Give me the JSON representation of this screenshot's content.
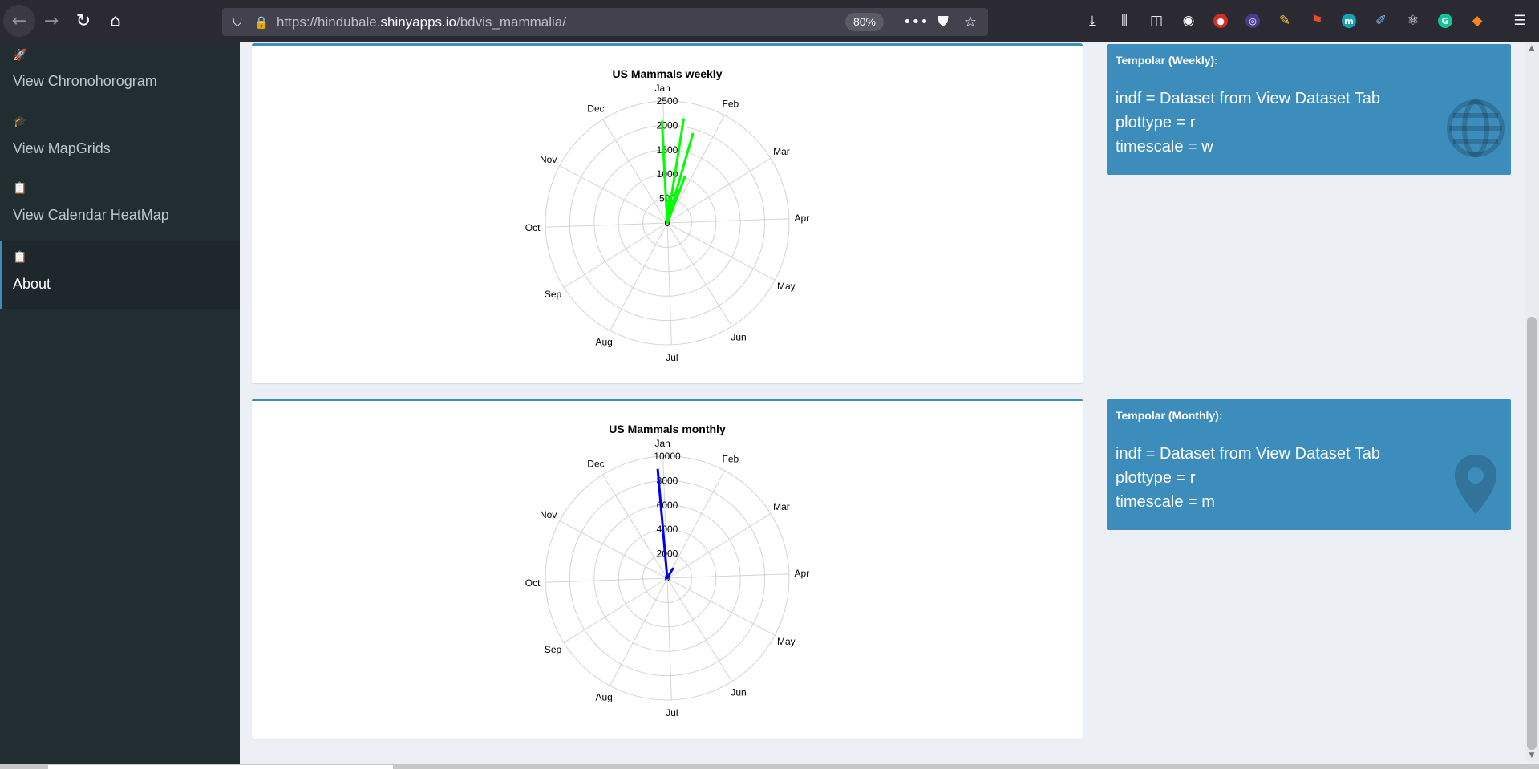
{
  "browser": {
    "url_prefix": "https://hindubale.",
    "url_domain": "shinyapps.io",
    "url_path": "/bdvis_mammalia/",
    "zoom": "80%",
    "icons": [
      "back-icon",
      "forward-icon",
      "reload-icon",
      "home-icon",
      "shield-icon",
      "lock-icon",
      "more-icon",
      "pocket-icon",
      "star-icon",
      "download-icon",
      "library-icon",
      "sidebar-icon",
      "account-icon",
      "extensions"
    ]
  },
  "sidebar": {
    "items": [
      {
        "label": "View Chronohorogram",
        "icon": "rocket-icon",
        "glyph": "🚀"
      },
      {
        "label": "View MapGrids",
        "icon": "graduation-cap-icon",
        "glyph": "🎓"
      },
      {
        "label": "View Calendar HeatMap",
        "icon": "clipboard-icon",
        "glyph": "📋"
      },
      {
        "label": "About",
        "icon": "clipboard-icon",
        "glyph": "📋",
        "active": true
      }
    ]
  },
  "colors": {
    "accent": "#3c8dbc",
    "weekly_series": "#00ff00",
    "monthly_series": "#0000ee",
    "sidebar_bg": "#222d32"
  },
  "info_boxes": [
    {
      "title": "Tempolar (Weekly):",
      "lines": [
        "indf = Dataset from View Dataset Tab",
        "plottype = r",
        "timescale = w"
      ],
      "icon": "globe-icon"
    },
    {
      "title": "Tempolar (Monthly):",
      "lines": [
        "indf = Dataset from View Dataset Tab",
        "plottype = r",
        "timescale = m"
      ],
      "icon": "map-marker-icon"
    }
  ],
  "chart_data": [
    {
      "type": "line",
      "polar": true,
      "title": "US Mammals weekly",
      "angular_labels": [
        "Jan",
        "Feb",
        "Mar",
        "Apr",
        "May",
        "Jun",
        "Jul",
        "Aug",
        "Sep",
        "Oct",
        "Nov",
        "Dec"
      ],
      "radial_ticks": [
        0,
        500,
        1000,
        1500,
        2000,
        2500
      ],
      "rlim": [
        0,
        2500
      ],
      "series": [
        {
          "color": "#00ff00",
          "points": [
            {
              "angle_deg": 357,
              "value": 2100
            },
            {
              "angle_deg": 360,
              "value": 0
            },
            {
              "angle_deg": 9,
              "value": 2150
            },
            {
              "angle_deg": 360,
              "value": 0
            },
            {
              "angle_deg": 16,
              "value": 1900
            },
            {
              "angle_deg": 360,
              "value": 0
            },
            {
              "angle_deg": 21,
              "value": 1000
            },
            {
              "angle_deg": 360,
              "value": 0
            },
            {
              "angle_deg": 5,
              "value": 500
            },
            {
              "angle_deg": 360,
              "value": 0
            }
          ]
        }
      ]
    },
    {
      "type": "line",
      "polar": true,
      "title": "US Mammals monthly",
      "angular_labels": [
        "Jan",
        "Feb",
        "Mar",
        "Apr",
        "May",
        "Jun",
        "Jul",
        "Aug",
        "Sep",
        "Oct",
        "Nov",
        "Dec"
      ],
      "radial_ticks": [
        0,
        2000,
        4000,
        6000,
        8000,
        10000
      ],
      "rlim": [
        0,
        10000
      ],
      "series": [
        {
          "color": "#0000ee",
          "points": [
            {
              "angle_deg": 355,
              "value": 9000
            },
            {
              "angle_deg": 0,
              "value": 0
            },
            {
              "angle_deg": 30,
              "value": 900
            },
            {
              "angle_deg": 0,
              "value": 0
            }
          ]
        }
      ]
    }
  ]
}
